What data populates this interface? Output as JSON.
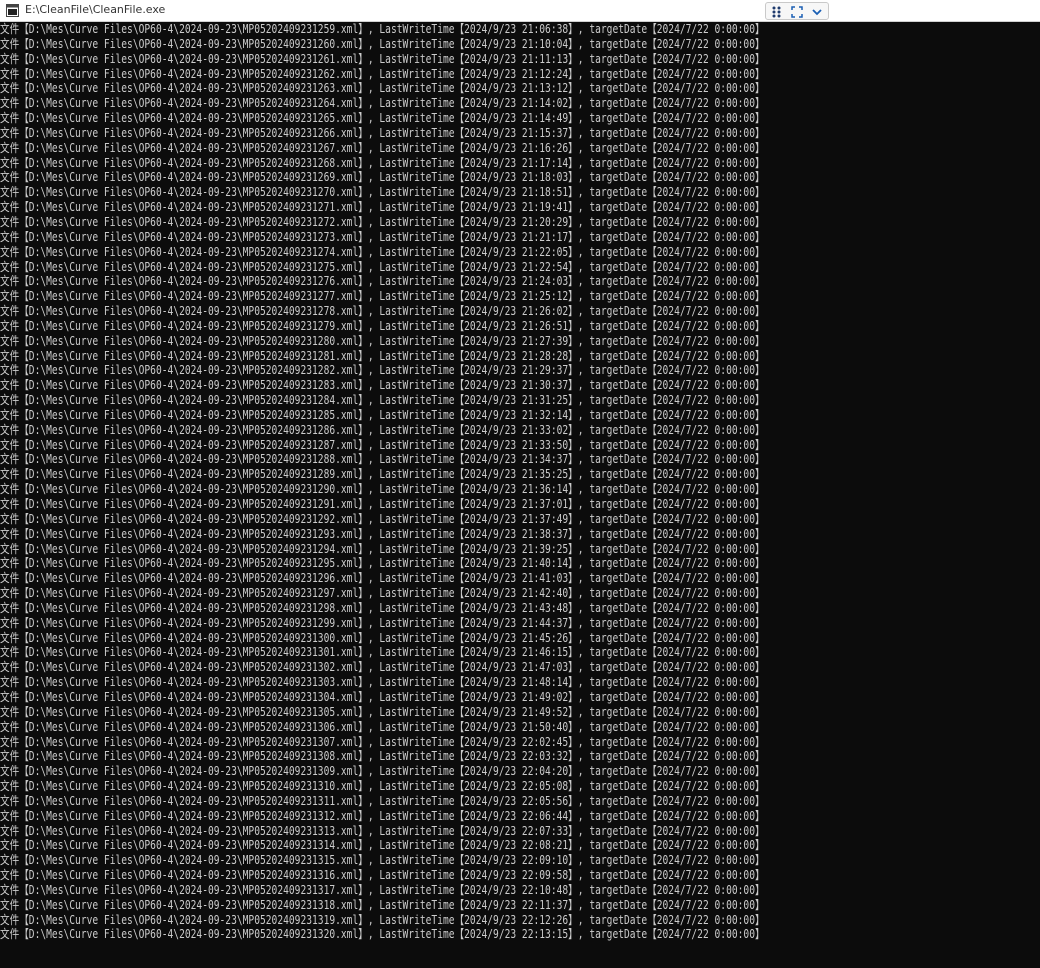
{
  "window": {
    "title": "E:\\CleanFile\\CleanFile.exe",
    "icons": {
      "app": "console-app-icon",
      "grip": "grip-dots-icon",
      "fit": "fit-screen-icon",
      "menu": "chevron-down-icon"
    },
    "colors": {
      "background": "#0c0c0c",
      "text": "#cccccc",
      "accent": "#1a5fb4"
    }
  },
  "console": {
    "lines": [
      "文件【D:\\Mes\\Curve Files\\OP60-4\\2024-09-23\\MP05202409231259.xml】, LastWriteTime【2024/9/23 21:06:38】, targetDate【2024/7/22 0:00:00】",
      "文件【D:\\Mes\\Curve Files\\OP60-4\\2024-09-23\\MP05202409231260.xml】, LastWriteTime【2024/9/23 21:10:04】, targetDate【2024/7/22 0:00:00】",
      "文件【D:\\Mes\\Curve Files\\OP60-4\\2024-09-23\\MP05202409231261.xml】, LastWriteTime【2024/9/23 21:11:13】, targetDate【2024/7/22 0:00:00】",
      "文件【D:\\Mes\\Curve Files\\OP60-4\\2024-09-23\\MP05202409231262.xml】, LastWriteTime【2024/9/23 21:12:24】, targetDate【2024/7/22 0:00:00】",
      "文件【D:\\Mes\\Curve Files\\OP60-4\\2024-09-23\\MP05202409231263.xml】, LastWriteTime【2024/9/23 21:13:12】, targetDate【2024/7/22 0:00:00】",
      "文件【D:\\Mes\\Curve Files\\OP60-4\\2024-09-23\\MP05202409231264.xml】, LastWriteTime【2024/9/23 21:14:02】, targetDate【2024/7/22 0:00:00】",
      "文件【D:\\Mes\\Curve Files\\OP60-4\\2024-09-23\\MP05202409231265.xml】, LastWriteTime【2024/9/23 21:14:49】, targetDate【2024/7/22 0:00:00】",
      "文件【D:\\Mes\\Curve Files\\OP60-4\\2024-09-23\\MP05202409231266.xml】, LastWriteTime【2024/9/23 21:15:37】, targetDate【2024/7/22 0:00:00】",
      "文件【D:\\Mes\\Curve Files\\OP60-4\\2024-09-23\\MP05202409231267.xml】, LastWriteTime【2024/9/23 21:16:26】, targetDate【2024/7/22 0:00:00】",
      "文件【D:\\Mes\\Curve Files\\OP60-4\\2024-09-23\\MP05202409231268.xml】, LastWriteTime【2024/9/23 21:17:14】, targetDate【2024/7/22 0:00:00】",
      "文件【D:\\Mes\\Curve Files\\OP60-4\\2024-09-23\\MP05202409231269.xml】, LastWriteTime【2024/9/23 21:18:03】, targetDate【2024/7/22 0:00:00】",
      "文件【D:\\Mes\\Curve Files\\OP60-4\\2024-09-23\\MP05202409231270.xml】, LastWriteTime【2024/9/23 21:18:51】, targetDate【2024/7/22 0:00:00】",
      "文件【D:\\Mes\\Curve Files\\OP60-4\\2024-09-23\\MP05202409231271.xml】, LastWriteTime【2024/9/23 21:19:41】, targetDate【2024/7/22 0:00:00】",
      "文件【D:\\Mes\\Curve Files\\OP60-4\\2024-09-23\\MP05202409231272.xml】, LastWriteTime【2024/9/23 21:20:29】, targetDate【2024/7/22 0:00:00】",
      "文件【D:\\Mes\\Curve Files\\OP60-4\\2024-09-23\\MP05202409231273.xml】, LastWriteTime【2024/9/23 21:21:17】, targetDate【2024/7/22 0:00:00】",
      "文件【D:\\Mes\\Curve Files\\OP60-4\\2024-09-23\\MP05202409231274.xml】, LastWriteTime【2024/9/23 21:22:05】, targetDate【2024/7/22 0:00:00】",
      "文件【D:\\Mes\\Curve Files\\OP60-4\\2024-09-23\\MP05202409231275.xml】, LastWriteTime【2024/9/23 21:22:54】, targetDate【2024/7/22 0:00:00】",
      "文件【D:\\Mes\\Curve Files\\OP60-4\\2024-09-23\\MP05202409231276.xml】, LastWriteTime【2024/9/23 21:24:03】, targetDate【2024/7/22 0:00:00】",
      "文件【D:\\Mes\\Curve Files\\OP60-4\\2024-09-23\\MP05202409231277.xml】, LastWriteTime【2024/9/23 21:25:12】, targetDate【2024/7/22 0:00:00】",
      "文件【D:\\Mes\\Curve Files\\OP60-4\\2024-09-23\\MP05202409231278.xml】, LastWriteTime【2024/9/23 21:26:02】, targetDate【2024/7/22 0:00:00】",
      "文件【D:\\Mes\\Curve Files\\OP60-4\\2024-09-23\\MP05202409231279.xml】, LastWriteTime【2024/9/23 21:26:51】, targetDate【2024/7/22 0:00:00】",
      "文件【D:\\Mes\\Curve Files\\OP60-4\\2024-09-23\\MP05202409231280.xml】, LastWriteTime【2024/9/23 21:27:39】, targetDate【2024/7/22 0:00:00】",
      "文件【D:\\Mes\\Curve Files\\OP60-4\\2024-09-23\\MP05202409231281.xml】, LastWriteTime【2024/9/23 21:28:28】, targetDate【2024/7/22 0:00:00】",
      "文件【D:\\Mes\\Curve Files\\OP60-4\\2024-09-23\\MP05202409231282.xml】, LastWriteTime【2024/9/23 21:29:37】, targetDate【2024/7/22 0:00:00】",
      "文件【D:\\Mes\\Curve Files\\OP60-4\\2024-09-23\\MP05202409231283.xml】, LastWriteTime【2024/9/23 21:30:37】, targetDate【2024/7/22 0:00:00】",
      "文件【D:\\Mes\\Curve Files\\OP60-4\\2024-09-23\\MP05202409231284.xml】, LastWriteTime【2024/9/23 21:31:25】, targetDate【2024/7/22 0:00:00】",
      "文件【D:\\Mes\\Curve Files\\OP60-4\\2024-09-23\\MP05202409231285.xml】, LastWriteTime【2024/9/23 21:32:14】, targetDate【2024/7/22 0:00:00】",
      "文件【D:\\Mes\\Curve Files\\OP60-4\\2024-09-23\\MP05202409231286.xml】, LastWriteTime【2024/9/23 21:33:02】, targetDate【2024/7/22 0:00:00】",
      "文件【D:\\Mes\\Curve Files\\OP60-4\\2024-09-23\\MP05202409231287.xml】, LastWriteTime【2024/9/23 21:33:50】, targetDate【2024/7/22 0:00:00】",
      "文件【D:\\Mes\\Curve Files\\OP60-4\\2024-09-23\\MP05202409231288.xml】, LastWriteTime【2024/9/23 21:34:37】, targetDate【2024/7/22 0:00:00】",
      "文件【D:\\Mes\\Curve Files\\OP60-4\\2024-09-23\\MP05202409231289.xml】, LastWriteTime【2024/9/23 21:35:25】, targetDate【2024/7/22 0:00:00】",
      "文件【D:\\Mes\\Curve Files\\OP60-4\\2024-09-23\\MP05202409231290.xml】, LastWriteTime【2024/9/23 21:36:14】, targetDate【2024/7/22 0:00:00】",
      "文件【D:\\Mes\\Curve Files\\OP60-4\\2024-09-23\\MP05202409231291.xml】, LastWriteTime【2024/9/23 21:37:01】, targetDate【2024/7/22 0:00:00】",
      "文件【D:\\Mes\\Curve Files\\OP60-4\\2024-09-23\\MP05202409231292.xml】, LastWriteTime【2024/9/23 21:37:49】, targetDate【2024/7/22 0:00:00】",
      "文件【D:\\Mes\\Curve Files\\OP60-4\\2024-09-23\\MP05202409231293.xml】, LastWriteTime【2024/9/23 21:38:37】, targetDate【2024/7/22 0:00:00】",
      "文件【D:\\Mes\\Curve Files\\OP60-4\\2024-09-23\\MP05202409231294.xml】, LastWriteTime【2024/9/23 21:39:25】, targetDate【2024/7/22 0:00:00】",
      "文件【D:\\Mes\\Curve Files\\OP60-4\\2024-09-23\\MP05202409231295.xml】, LastWriteTime【2024/9/23 21:40:14】, targetDate【2024/7/22 0:00:00】",
      "文件【D:\\Mes\\Curve Files\\OP60-4\\2024-09-23\\MP05202409231296.xml】, LastWriteTime【2024/9/23 21:41:03】, targetDate【2024/7/22 0:00:00】",
      "文件【D:\\Mes\\Curve Files\\OP60-4\\2024-09-23\\MP05202409231297.xml】, LastWriteTime【2024/9/23 21:42:40】, targetDate【2024/7/22 0:00:00】",
      "文件【D:\\Mes\\Curve Files\\OP60-4\\2024-09-23\\MP05202409231298.xml】, LastWriteTime【2024/9/23 21:43:48】, targetDate【2024/7/22 0:00:00】",
      "文件【D:\\Mes\\Curve Files\\OP60-4\\2024-09-23\\MP05202409231299.xml】, LastWriteTime【2024/9/23 21:44:37】, targetDate【2024/7/22 0:00:00】",
      "文件【D:\\Mes\\Curve Files\\OP60-4\\2024-09-23\\MP05202409231300.xml】, LastWriteTime【2024/9/23 21:45:26】, targetDate【2024/7/22 0:00:00】",
      "文件【D:\\Mes\\Curve Files\\OP60-4\\2024-09-23\\MP05202409231301.xml】, LastWriteTime【2024/9/23 21:46:15】, targetDate【2024/7/22 0:00:00】",
      "文件【D:\\Mes\\Curve Files\\OP60-4\\2024-09-23\\MP05202409231302.xml】, LastWriteTime【2024/9/23 21:47:03】, targetDate【2024/7/22 0:00:00】",
      "文件【D:\\Mes\\Curve Files\\OP60-4\\2024-09-23\\MP05202409231303.xml】, LastWriteTime【2024/9/23 21:48:14】, targetDate【2024/7/22 0:00:00】",
      "文件【D:\\Mes\\Curve Files\\OP60-4\\2024-09-23\\MP05202409231304.xml】, LastWriteTime【2024/9/23 21:49:02】, targetDate【2024/7/22 0:00:00】",
      "文件【D:\\Mes\\Curve Files\\OP60-4\\2024-09-23\\MP05202409231305.xml】, LastWriteTime【2024/9/23 21:49:52】, targetDate【2024/7/22 0:00:00】",
      "文件【D:\\Mes\\Curve Files\\OP60-4\\2024-09-23\\MP05202409231306.xml】, LastWriteTime【2024/9/23 21:50:40】, targetDate【2024/7/22 0:00:00】",
      "文件【D:\\Mes\\Curve Files\\OP60-4\\2024-09-23\\MP05202409231307.xml】, LastWriteTime【2024/9/23 22:02:45】, targetDate【2024/7/22 0:00:00】",
      "文件【D:\\Mes\\Curve Files\\OP60-4\\2024-09-23\\MP05202409231308.xml】, LastWriteTime【2024/9/23 22:03:32】, targetDate【2024/7/22 0:00:00】",
      "文件【D:\\Mes\\Curve Files\\OP60-4\\2024-09-23\\MP05202409231309.xml】, LastWriteTime【2024/9/23 22:04:20】, targetDate【2024/7/22 0:00:00】",
      "文件【D:\\Mes\\Curve Files\\OP60-4\\2024-09-23\\MP05202409231310.xml】, LastWriteTime【2024/9/23 22:05:08】, targetDate【2024/7/22 0:00:00】",
      "文件【D:\\Mes\\Curve Files\\OP60-4\\2024-09-23\\MP05202409231311.xml】, LastWriteTime【2024/9/23 22:05:56】, targetDate【2024/7/22 0:00:00】",
      "文件【D:\\Mes\\Curve Files\\OP60-4\\2024-09-23\\MP05202409231312.xml】, LastWriteTime【2024/9/23 22:06:44】, targetDate【2024/7/22 0:00:00】",
      "文件【D:\\Mes\\Curve Files\\OP60-4\\2024-09-23\\MP05202409231313.xml】, LastWriteTime【2024/9/23 22:07:33】, targetDate【2024/7/22 0:00:00】",
      "文件【D:\\Mes\\Curve Files\\OP60-4\\2024-09-23\\MP05202409231314.xml】, LastWriteTime【2024/9/23 22:08:21】, targetDate【2024/7/22 0:00:00】",
      "文件【D:\\Mes\\Curve Files\\OP60-4\\2024-09-23\\MP05202409231315.xml】, LastWriteTime【2024/9/23 22:09:10】, targetDate【2024/7/22 0:00:00】",
      "文件【D:\\Mes\\Curve Files\\OP60-4\\2024-09-23\\MP05202409231316.xml】, LastWriteTime【2024/9/23 22:09:58】, targetDate【2024/7/22 0:00:00】",
      "文件【D:\\Mes\\Curve Files\\OP60-4\\2024-09-23\\MP05202409231317.xml】, LastWriteTime【2024/9/23 22:10:48】, targetDate【2024/7/22 0:00:00】",
      "文件【D:\\Mes\\Curve Files\\OP60-4\\2024-09-23\\MP05202409231318.xml】, LastWriteTime【2024/9/23 22:11:37】, targetDate【2024/7/22 0:00:00】",
      "文件【D:\\Mes\\Curve Files\\OP60-4\\2024-09-23\\MP05202409231319.xml】, LastWriteTime【2024/9/23 22:12:26】, targetDate【2024/7/22 0:00:00】",
      "文件【D:\\Mes\\Curve Files\\OP60-4\\2024-09-23\\MP05202409231320.xml】, LastWriteTime【2024/9/23 22:13:15】, targetDate【2024/7/22 0:00:00】"
    ]
  }
}
